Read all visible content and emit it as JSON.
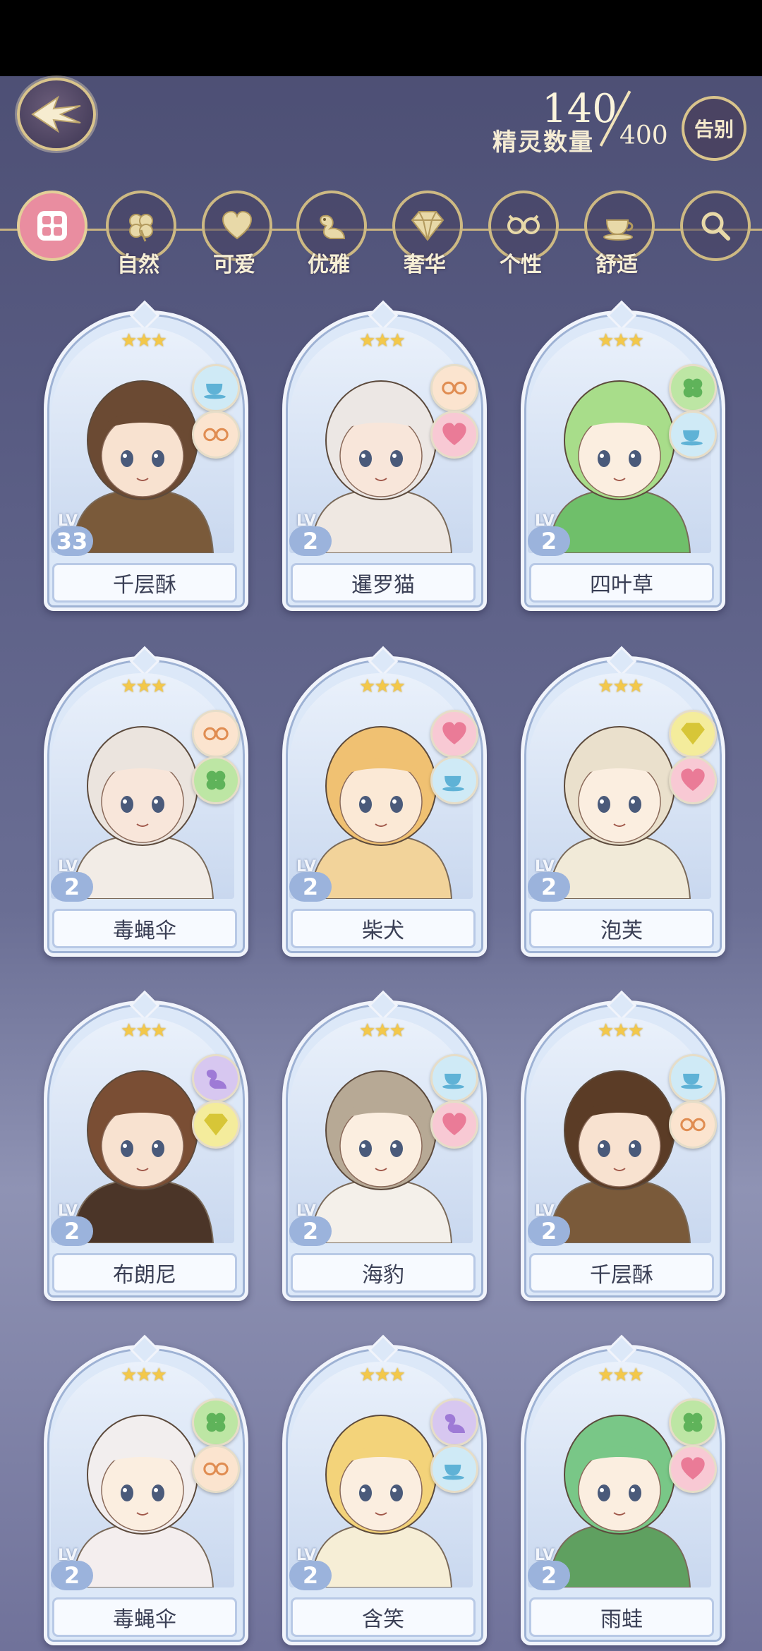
{
  "header": {
    "count_label": "精灵数量",
    "count_current": "140",
    "count_max": "400",
    "farewell_label": "告别"
  },
  "filters": [
    {
      "label": "",
      "icon": "grid-icon",
      "active": true
    },
    {
      "label": "自然",
      "icon": "clover-icon"
    },
    {
      "label": "可爱",
      "icon": "heart-icon"
    },
    {
      "label": "优雅",
      "icon": "swan-icon"
    },
    {
      "label": "奢华",
      "icon": "diamond-icon"
    },
    {
      "label": "个性",
      "icon": "glasses-icon"
    },
    {
      "label": "舒适",
      "icon": "teacup-icon"
    },
    {
      "label": "",
      "icon": "search-icon"
    }
  ],
  "cards": [
    {
      "name": "千层酥",
      "level": "33",
      "stars": "★★★",
      "badges": [
        "teacup-icon",
        "glasses-icon"
      ],
      "hair": "#6b4a33",
      "skin": "#f8e2d0",
      "outfit": "#7a5a3a"
    },
    {
      "name": "暹罗猫",
      "level": "2",
      "stars": "★★★",
      "badges": [
        "glasses-icon",
        "heart-icon"
      ],
      "hair": "#ece7e4",
      "skin": "#f8e6da",
      "outfit": "#efe8e2"
    },
    {
      "name": "四叶草",
      "level": "2",
      "stars": "★★★",
      "badges": [
        "clover-icon",
        "teacup-icon"
      ],
      "hair": "#a8dd8a",
      "skin": "#fbeee0",
      "outfit": "#6fbf6a"
    },
    {
      "name": "毒蝇伞",
      "level": "2",
      "stars": "★★★",
      "badges": [
        "glasses-icon",
        "clover-icon"
      ],
      "hair": "#ebe4de",
      "skin": "#f8e6da",
      "outfit": "#f2ece6"
    },
    {
      "name": "柴犬",
      "level": "2",
      "stars": "★★★",
      "badges": [
        "heart-icon",
        "teacup-icon"
      ],
      "hair": "#f0c172",
      "skin": "#fbe9d6",
      "outfit": "#f2d39a"
    },
    {
      "name": "泡芙",
      "level": "2",
      "stars": "★★★",
      "badges": [
        "diamond-icon",
        "heart-icon"
      ],
      "hair": "#eae0cc",
      "skin": "#fbeee0",
      "outfit": "#f1ead8"
    },
    {
      "name": "布朗尼",
      "level": "2",
      "stars": "★★★",
      "badges": [
        "swan-icon",
        "diamond-icon"
      ],
      "hair": "#7a4e34",
      "skin": "#f8e2d0",
      "outfit": "#4b3528"
    },
    {
      "name": "海豹",
      "level": "2",
      "stars": "★★★",
      "badges": [
        "teacup-icon",
        "heart-icon"
      ],
      "hair": "#b7a995",
      "skin": "#fbeee0",
      "outfit": "#f4f0ea"
    },
    {
      "name": "千层酥",
      "level": "2",
      "stars": "★★★",
      "badges": [
        "teacup-icon",
        "glasses-icon"
      ],
      "hair": "#5b3c26",
      "skin": "#f8e2d0",
      "outfit": "#7a5a3a"
    },
    {
      "name": "毒蝇伞",
      "level": "2",
      "stars": "★★★",
      "badges": [
        "clover-icon",
        "glasses-icon"
      ],
      "hair": "#f2eeee",
      "skin": "#fbeee0",
      "outfit": "#f4eeee"
    },
    {
      "name": "含笑",
      "level": "2",
      "stars": "★★★",
      "badges": [
        "swan-icon",
        "teacup-icon"
      ],
      "hair": "#f3d37a",
      "skin": "#fbeee0",
      "outfit": "#f6eed6"
    },
    {
      "name": "雨蛙",
      "level": "2",
      "stars": "★★★",
      "badges": [
        "clover-icon",
        "heart-icon"
      ],
      "hair": "#79c787",
      "skin": "#fbeee0",
      "outfit": "#5fa060"
    }
  ]
}
